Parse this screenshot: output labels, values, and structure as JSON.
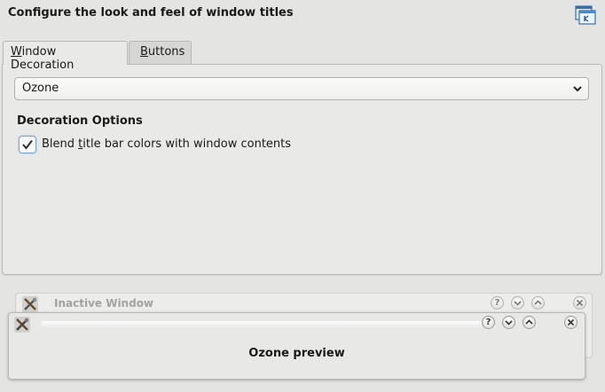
{
  "header": {
    "title": "Configure the look and feel of window titles",
    "icon": "window-config-icon"
  },
  "tabs": [
    {
      "label": "Window Decoration",
      "mnemonic": "W",
      "rest": "indow Decoration",
      "active": true
    },
    {
      "label": "Buttons",
      "mnemonic": "B",
      "rest": "uttons",
      "active": false
    }
  ],
  "decoration": {
    "selected": "Ozone",
    "section_title": "Decoration Options",
    "blend_option": {
      "label": "Blend title bar colors with window contents",
      "before": "Blend ",
      "mnemonic": "t",
      "after": "itle bar colors with window contents",
      "checked": true
    }
  },
  "preview": {
    "inactive_window_title": "Inactive Window",
    "active_window_title": "",
    "preview_text": "Ozone preview",
    "buttons": [
      "help",
      "minimize",
      "maximize",
      "close"
    ],
    "help_glyph": "?"
  },
  "colors": {
    "background": "#e4e4e2",
    "checkbox_focus": "#7fa4cc"
  }
}
